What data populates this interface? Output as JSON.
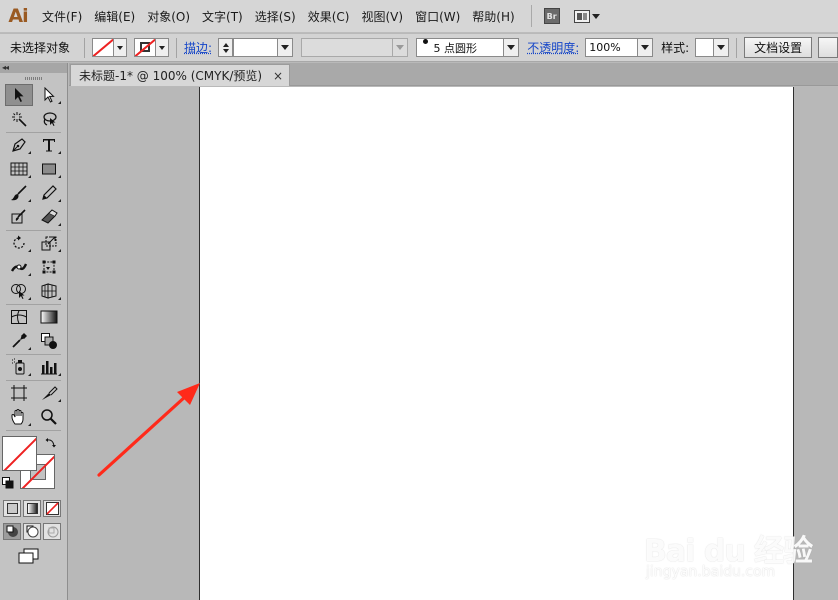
{
  "app": {
    "logo": "Ai"
  },
  "menus": [
    "文件(F)",
    "编辑(E)",
    "对象(O)",
    "文字(T)",
    "选择(S)",
    "效果(C)",
    "视图(V)",
    "窗口(W)",
    "帮助(H)"
  ],
  "menubar_extras": {
    "bridge_label": "Br"
  },
  "control_bar": {
    "selection_status": "未选择对象",
    "stroke_link": "描边:",
    "brush_value": "5 点圆形",
    "opacity_link": "不透明度:",
    "opacity_value": "100%",
    "style_label": "样式:",
    "doc_setup_button": "文档设置"
  },
  "tools_panel": {
    "collapse_glyph": "◂◂"
  },
  "document_tab": {
    "title": "未标题-1* @ 100% (CMYK/预览)",
    "close_glyph": "×"
  },
  "watermark": {
    "logo_text": "Bai du 经验",
    "url": "jingyan.baidu.com"
  },
  "colors": {
    "accent_link": "#1445c8",
    "annotation_arrow": "#ff2a1a",
    "logo_brown": "#9a5a22",
    "none_slash": "#e22222"
  }
}
